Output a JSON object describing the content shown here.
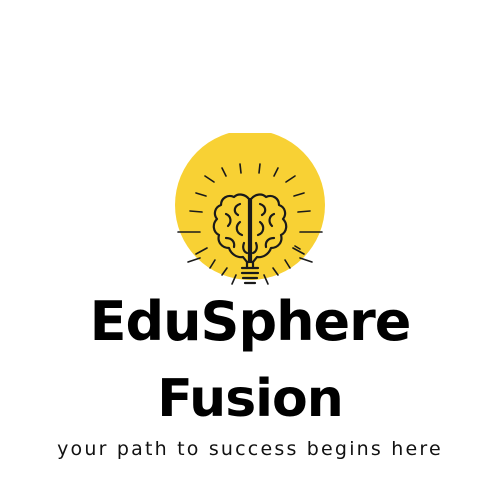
{
  "brand": {
    "name_line_1": "EduSphere",
    "name_line_2": "Fusion",
    "tagline": "your path to success begins here"
  },
  "logo": {
    "icon": "lightbulb-brain-icon",
    "accent_color": "#F8D134",
    "line_color": "#1a1a1a"
  }
}
